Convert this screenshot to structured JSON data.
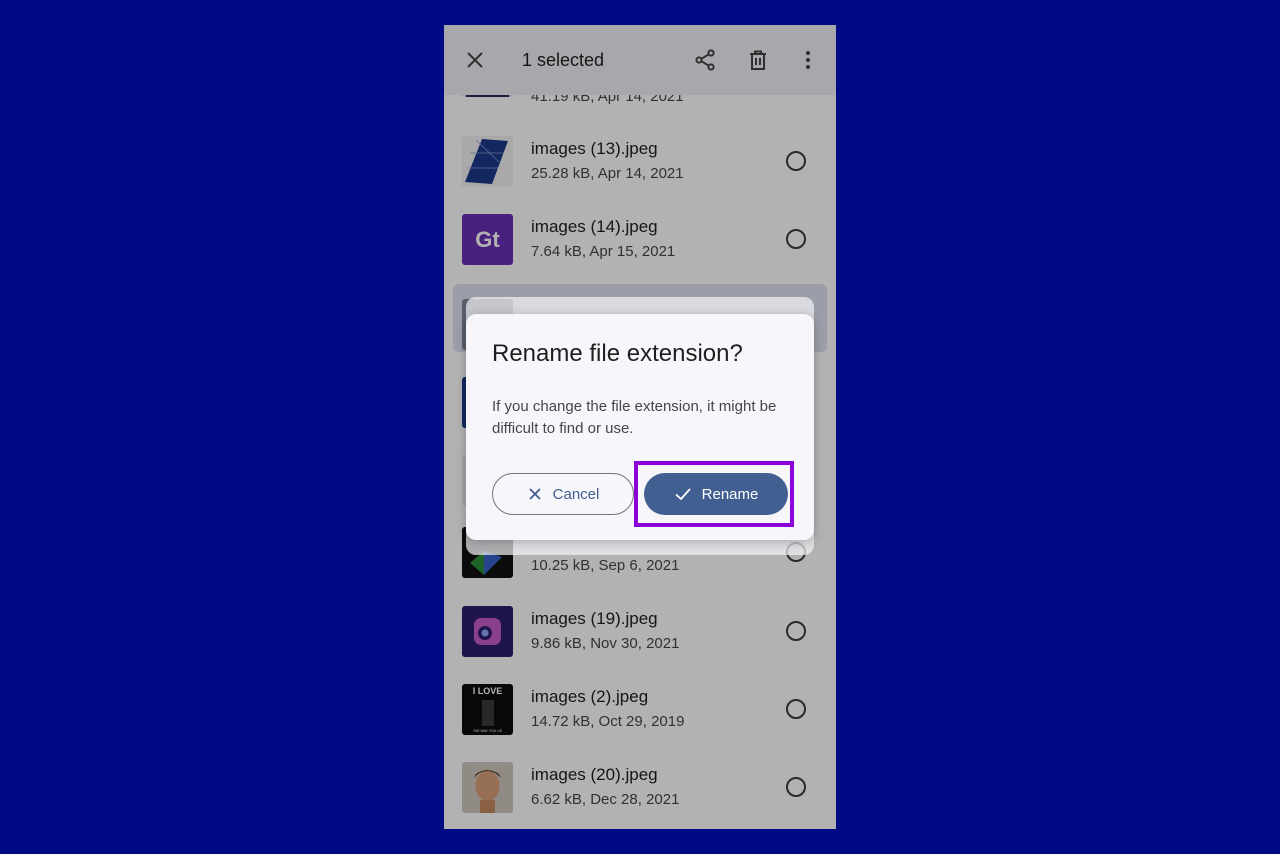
{
  "appbar": {
    "title": "1 selected",
    "close_icon": "close-icon",
    "share_icon": "share-icon",
    "delete_icon": "trash-icon",
    "more_icon": "more-vert-icon"
  },
  "files": [
    {
      "name": "",
      "meta": "41.19 kB, Apr 14, 2021",
      "thumb": "solar-panel-thumb"
    },
    {
      "name": "images (13).jpeg",
      "meta": "25.28 kB, Apr 14, 2021",
      "thumb": "solar-panel-thumb"
    },
    {
      "name": "images (14).jpeg",
      "meta": "7.64 kB, Apr 15, 2021",
      "thumb": "gt-logo-thumb"
    },
    {
      "name": "",
      "meta": "10.25 kB, Sep 6, 2021",
      "thumb": "dark-thumb"
    },
    {
      "name": "images (19).jpeg",
      "meta": "9.86 kB, Nov 30, 2021",
      "thumb": "camera-icon-thumb"
    },
    {
      "name": "images (2).jpeg",
      "meta": "14.72 kB, Oct 29, 2019",
      "thumb": "poster-thumb",
      "thumb_text": "I LOVE",
      "thumb_subtext": "THE WAY YOU LIE"
    },
    {
      "name": "images (20).jpeg",
      "meta": "6.62 kB, Dec 28, 2021",
      "thumb": "portrait-thumb"
    }
  ],
  "dialog": {
    "title": "Rename file extension?",
    "body": "If you change the file extension, it might be difficult to find or use.",
    "cancel_label": "Cancel",
    "rename_label": "Rename"
  },
  "colors": {
    "background": "#010a85",
    "primary": "#415f91",
    "highlight": "#8b00d8"
  }
}
